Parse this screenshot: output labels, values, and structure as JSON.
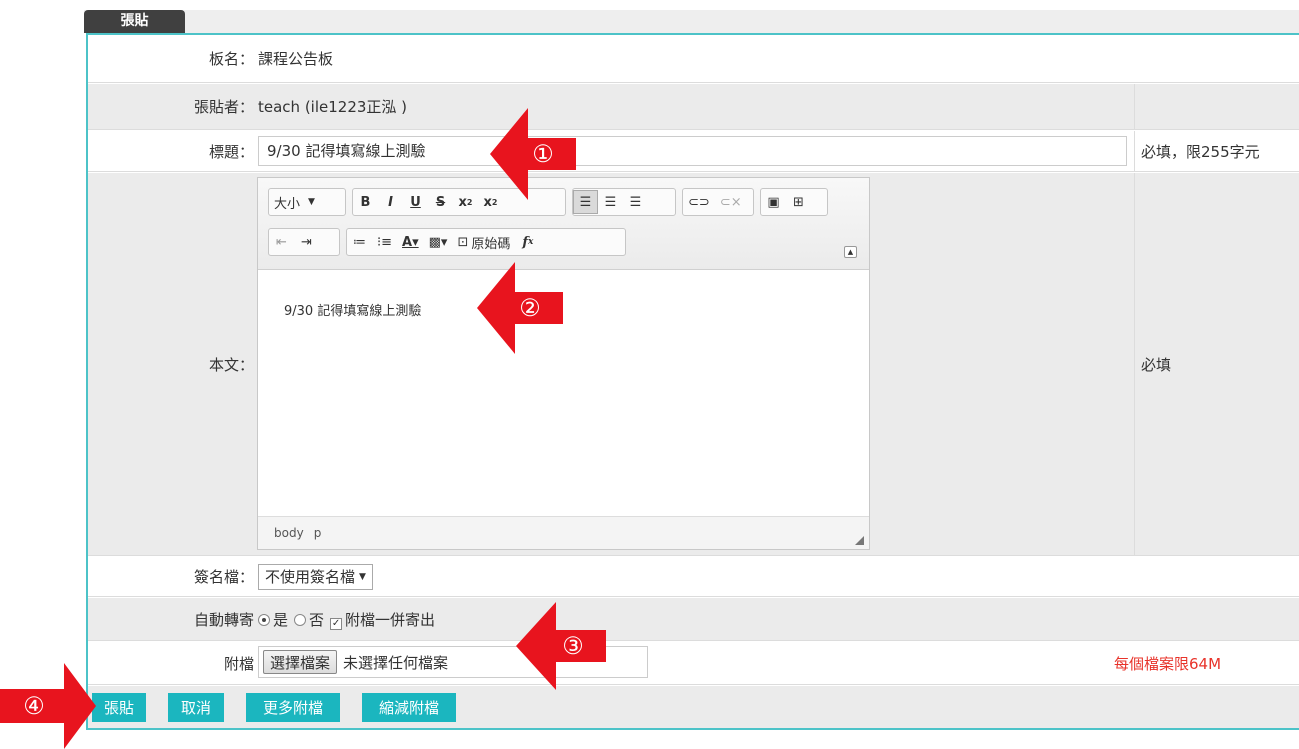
{
  "tab": {
    "label": "張貼"
  },
  "fields": {
    "board": {
      "label": "板名：",
      "value": "課程公告板"
    },
    "poster": {
      "label": "張貼者：",
      "value": "teach (ile1223正泓 )"
    },
    "title": {
      "label": "標題：",
      "value": "9/30 記得填寫線上測驗",
      "note": "必填，限255字元"
    },
    "body": {
      "label": "本文：",
      "value": "9/30 記得填寫線上測驗",
      "note": "必填"
    },
    "signature": {
      "label": "簽名檔：",
      "selected": "不使用簽名檔"
    },
    "forward": {
      "label": "自動轉寄",
      "yes": "是",
      "no": "否",
      "attach_label": "附檔一併寄出",
      "selected": "yes",
      "attach_checked": true
    },
    "attachment": {
      "label": "附檔",
      "button": "選擇檔案",
      "status": "未選擇任何檔案",
      "note": "每個檔案限64M"
    }
  },
  "editor": {
    "size_label": "大小",
    "source_label": "原始碼",
    "status_path": [
      "body",
      "p"
    ]
  },
  "buttons": {
    "post": "張貼",
    "cancel": "取消",
    "more": "更多附檔",
    "fewer": "縮減附檔"
  },
  "markers": [
    "①",
    "②",
    "③",
    "④"
  ],
  "colors": {
    "accent": "#1bb6bf",
    "frame": "#4cc3c8",
    "marker": "#e8141e",
    "note_red": "#e8332a"
  }
}
